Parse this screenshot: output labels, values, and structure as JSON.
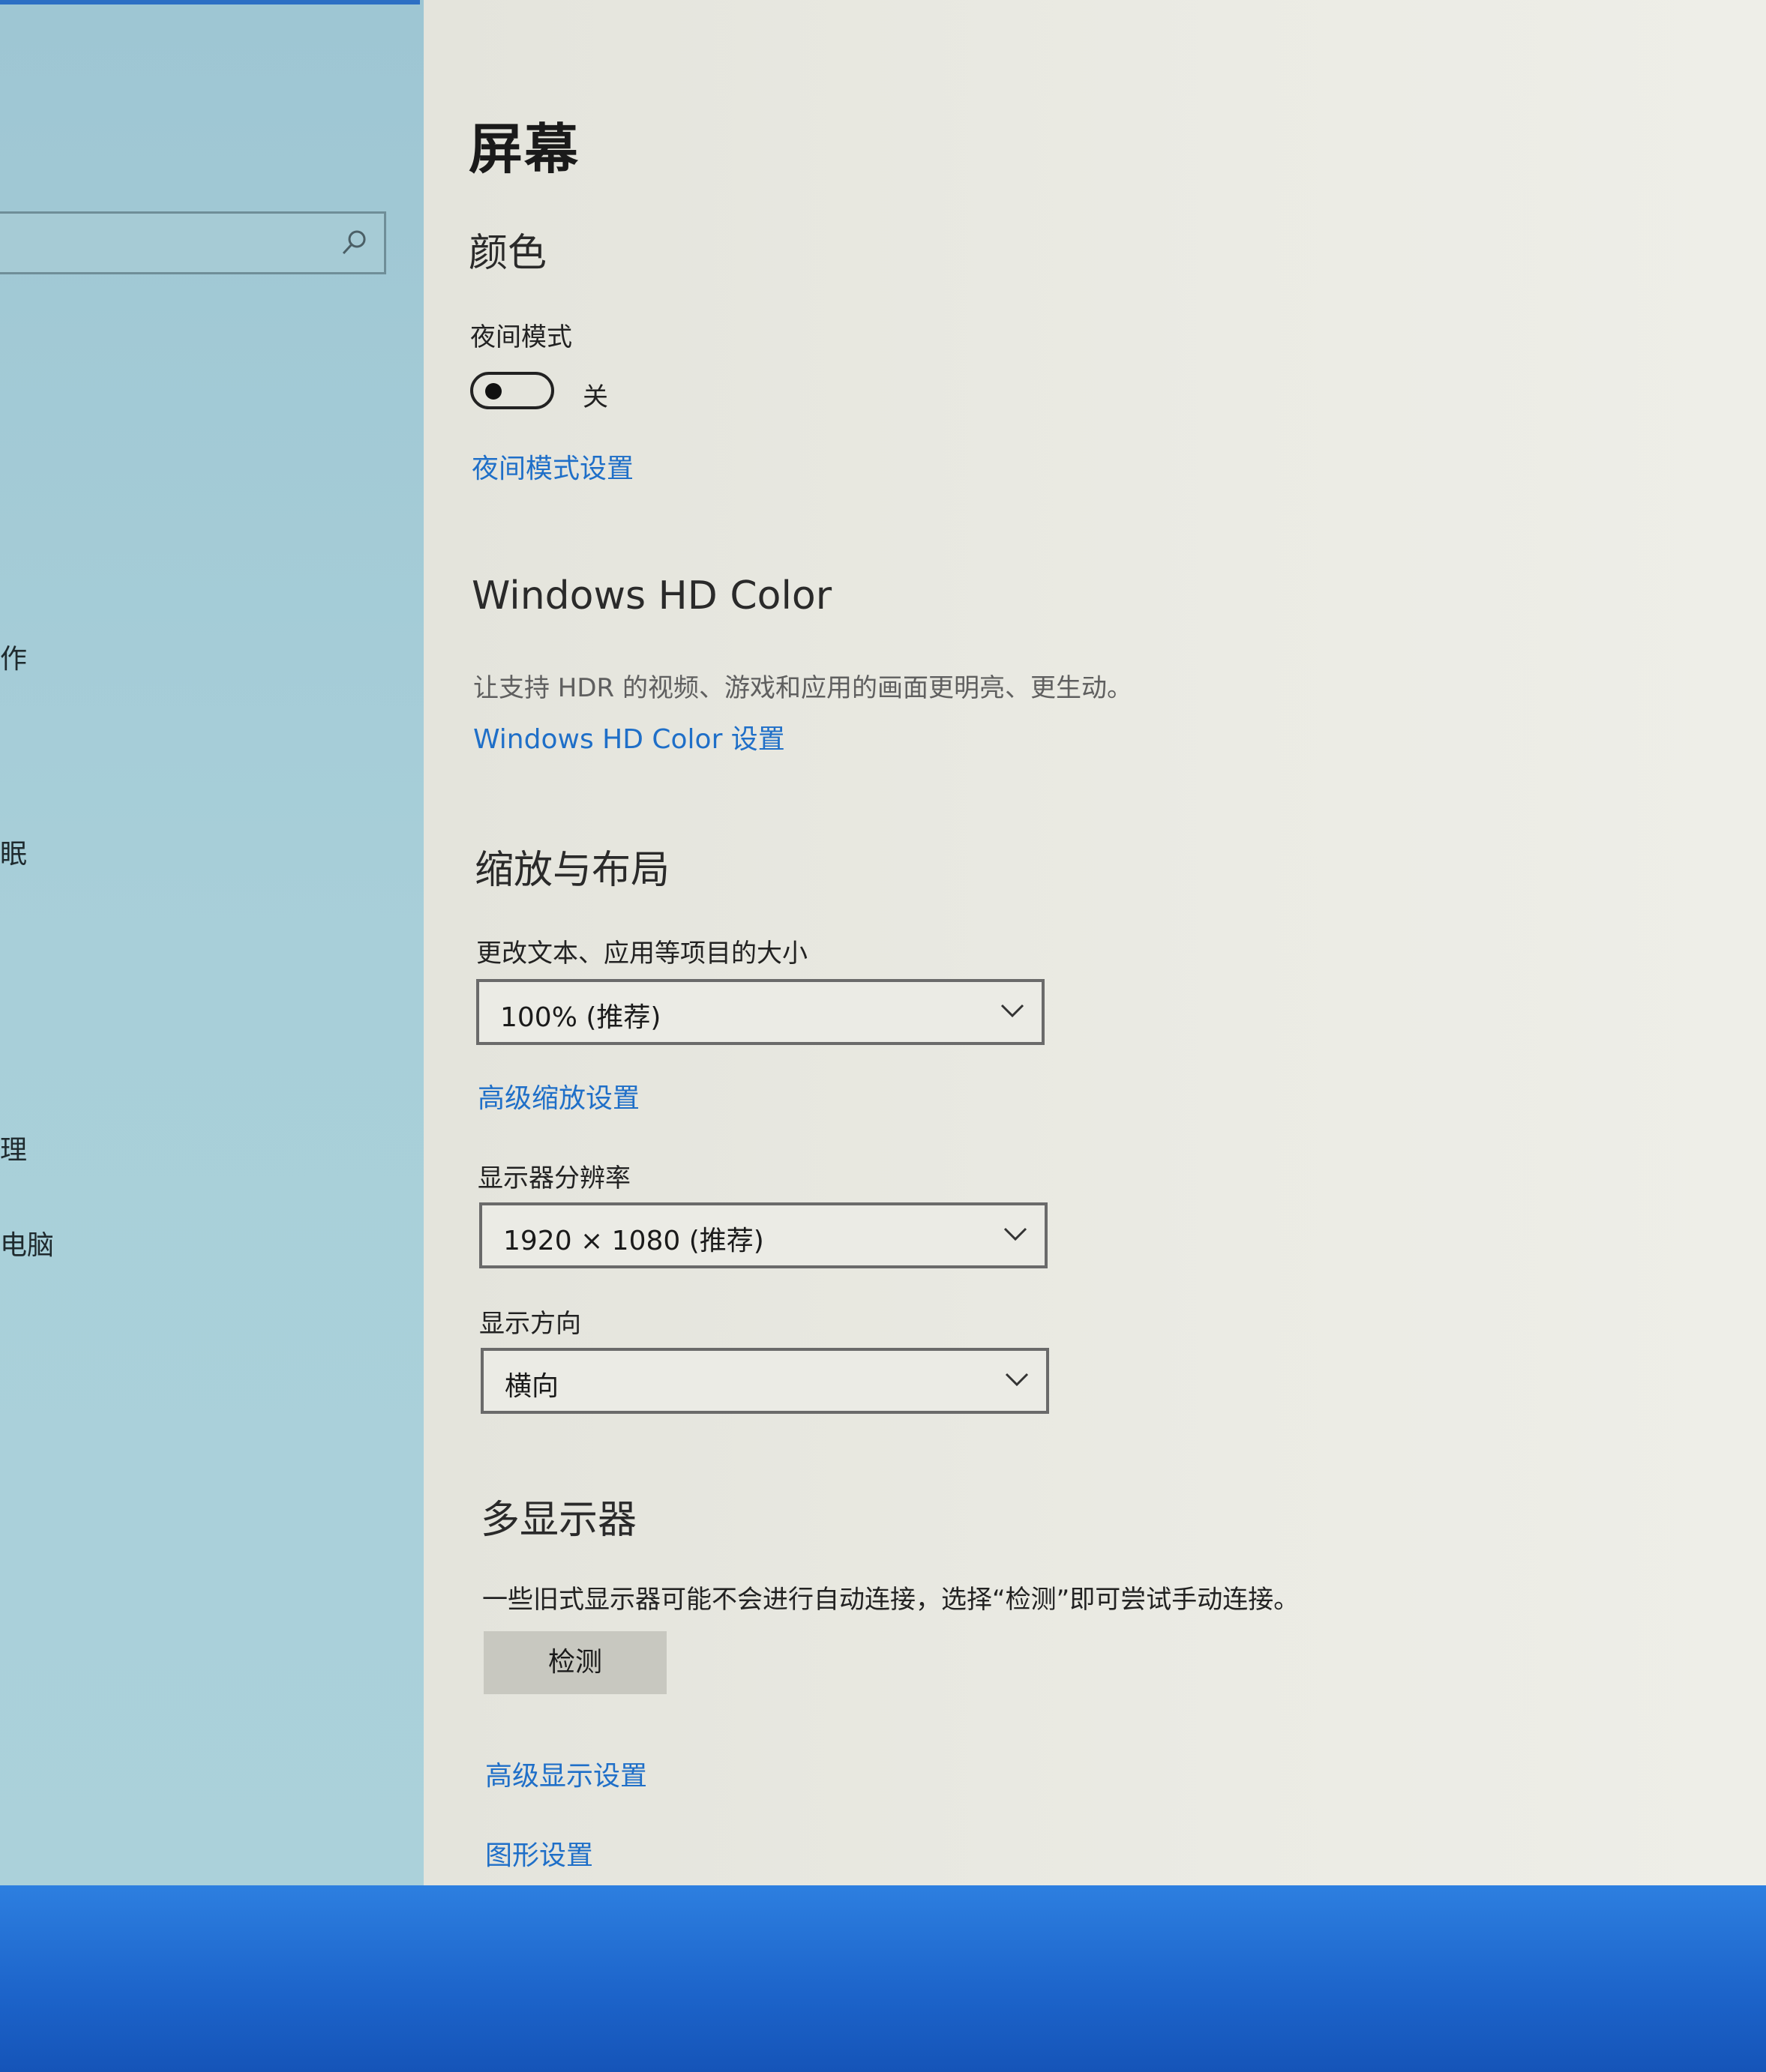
{
  "sidebar": {
    "search": {
      "placeholder": ""
    },
    "fragments": [
      "作",
      "眠",
      "理",
      "电脑"
    ]
  },
  "page": {
    "title": "屏幕"
  },
  "color": {
    "heading": "颜色",
    "night_mode_label": "夜间模式",
    "night_mode_state": "关",
    "night_mode_settings_link": "夜间模式设置"
  },
  "hd_color": {
    "heading": "Windows HD Color",
    "description": "让支持 HDR 的视频、游戏和应用的画面更明亮、更生动。",
    "settings_link": "Windows HD Color 设置"
  },
  "scale_layout": {
    "heading": "缩放与布局",
    "scale_label": "更改文本、应用等项目的大小",
    "scale_value": "100% (推荐)",
    "advanced_scaling_link": "高级缩放设置",
    "resolution_label": "显示器分辨率",
    "resolution_value": "1920 × 1080 (推荐)",
    "orientation_label": "显示方向",
    "orientation_value": "横向"
  },
  "multi_display": {
    "heading": "多显示器",
    "description": "一些旧式显示器可能不会进行自动连接，选择“检测”即可尝试手动连接。",
    "detect_button": "检测",
    "advanced_display_link": "高级显示设置",
    "graphics_settings_link": "图形设置"
  },
  "colors": {
    "link": "#1f6fc8",
    "sidebar": "#a8cfd9",
    "content": "#ebebe4",
    "desktop": "#1c63c9"
  }
}
